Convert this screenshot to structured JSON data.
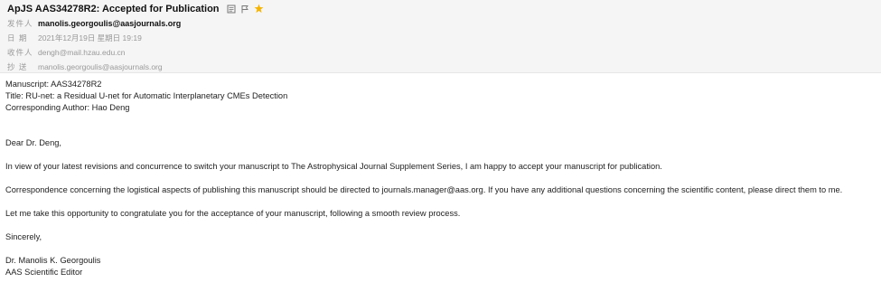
{
  "email": {
    "subject": "ApJS AAS34278R2: Accepted for Publication",
    "icons": [
      "mail-detail-icon",
      "flag-icon",
      "star-icon"
    ],
    "star_color": "#f5b400",
    "meta": {
      "from_label": "发件人",
      "from_value": "manolis.georgoulis@aasjournals.org",
      "date_label": "日  期",
      "date_value": "2021年12月19日 星期日 19:19",
      "to_label": "收件人",
      "to_value": "dengh@mail.hzau.edu.cn",
      "cc_label": "抄  送",
      "cc_value": "manolis.georgoulis@aasjournals.org"
    },
    "body": {
      "manuscript": "Manuscript: AAS34278R2",
      "title": "Title: RU-net: a Residual U-net for Automatic Interplanetary CMEs Detection",
      "author": "Corresponding Author: Hao Deng",
      "greeting": "Dear Dr. Deng,",
      "para1": "In view of your latest revisions and concurrence to switch your manuscript to The Astrophysical Journal Supplement Series, I am happy to accept your manuscript for publication.",
      "para2": "Correspondence concerning the logistical aspects of publishing this manuscript should be directed to journals.manager@aas.org. If you have any additional questions concerning the scientific content, please direct them to me.",
      "para3": "Let me take this opportunity to congratulate you for the acceptance of your manuscript, following a smooth review process.",
      "closing": "Sincerely,",
      "signature_name": "Dr. Manolis K. Georgoulis",
      "signature_title": "AAS Scientific Editor"
    }
  }
}
